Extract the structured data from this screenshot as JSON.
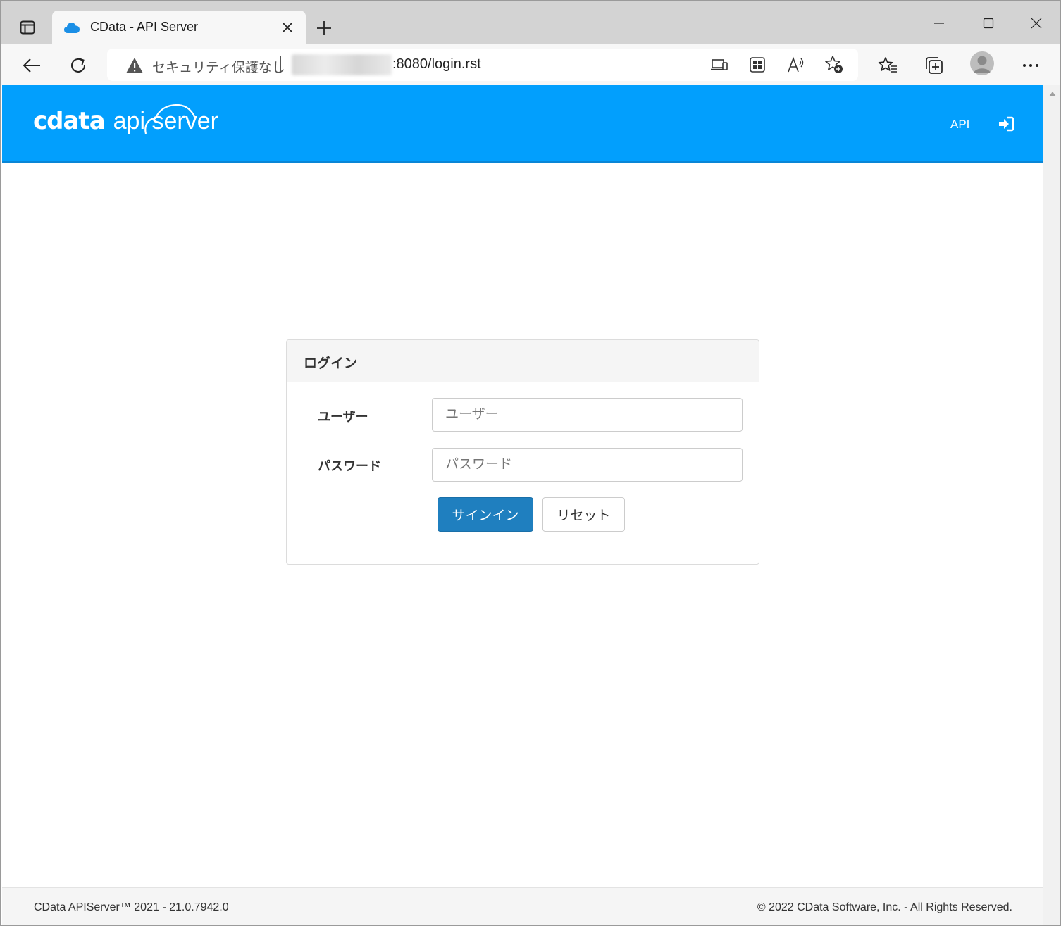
{
  "browser": {
    "tab_title": "CData - API Server",
    "address": {
      "security_text": "セキュリティ保護なし",
      "url_suffix": ":8080/login.rst"
    },
    "icons": {
      "tab_actions": "tab-actions-icon",
      "favicon": "cloud-icon",
      "close_tab": "close-icon",
      "new_tab": "plus-icon",
      "minimize": "minimize-icon",
      "maximize": "maximize-icon",
      "close_window": "close-icon",
      "back": "back-arrow-icon",
      "refresh": "refresh-icon",
      "warning": "warning-icon",
      "device": "device-icon",
      "app": "app-icon",
      "read_aloud": "read-aloud-icon",
      "add_favorite": "add-favorite-icon",
      "favorites": "favorites-icon",
      "collections": "collections-icon",
      "profile": "profile-icon",
      "more": "more-icon"
    }
  },
  "navbar": {
    "logo_text": "cdata",
    "logo_product": "api server",
    "api_link": "API",
    "login_icon": "sign-in-icon",
    "color": "#029ffd"
  },
  "login": {
    "title": "ログイン",
    "user_label": "ユーザー",
    "user_placeholder": "ユーザー",
    "password_label": "パスワード",
    "password_placeholder": "パスワード",
    "signin_label": "サインイン",
    "reset_label": "リセット",
    "primary_color": "#1f7fbf"
  },
  "footer": {
    "version": "CData APIServer™ 2021 - 21.0.7942.0",
    "copyright": "© 2022 CData Software, Inc. - All Rights Reserved."
  }
}
